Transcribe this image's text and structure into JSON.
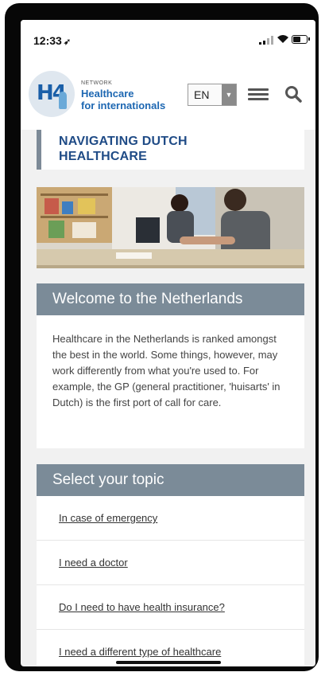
{
  "status_bar": {
    "time": "12:33",
    "location_glyph": "➶"
  },
  "header": {
    "logo_abbr": "H4",
    "network_label": "NETWORK",
    "brand_line1": "Healthcare",
    "brand_line2": "for internationals",
    "language": "EN",
    "icons": [
      "hamburger-menu-icon",
      "search-icon"
    ]
  },
  "page_title": "NAVIGATING DUTCH HEALTHCARE",
  "welcome": {
    "heading": "Welcome to the Netherlands",
    "body": "Healthcare in the Netherlands is ranked amongst the best in the world. Some things, however, may work differently from what you're used to. For example, the GP (general practitioner, 'huisarts' in Dutch) is the first port of call for care."
  },
  "topics": {
    "heading": "Select your topic",
    "items": [
      "In case of emergency",
      "I need a doctor",
      "Do I need to have health insurance?",
      "I need a different type of healthcare"
    ]
  },
  "colors": {
    "brand_blue": "#1d67b2",
    "title_blue": "#1f4b86",
    "panel_gray": "#7b8b98",
    "background": "#f1f1f1"
  }
}
